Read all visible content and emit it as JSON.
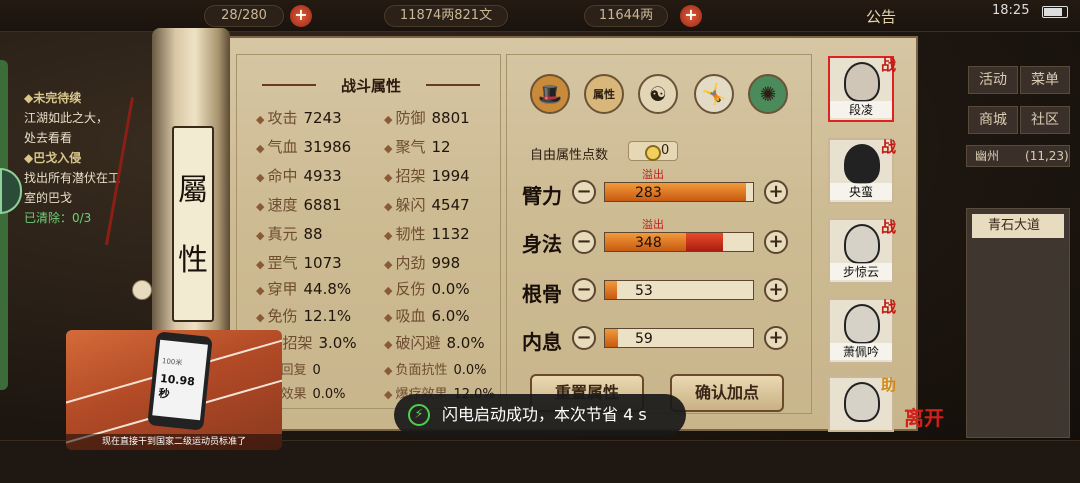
{
  "topbar": {
    "res1": "28/280",
    "res2": "11874两821文",
    "res3": "11644两",
    "notice": "公告",
    "time": "18:25"
  },
  "quest": {
    "title1": "◆未完待续",
    "desc1a": "江湖如此之大，",
    "desc1b": "处去看看",
    "title2": "◆巴戈入侵",
    "desc2a": "找出所有潜伏在工",
    "desc2b": "室的巴戈",
    "cleared": "已清除：0/3"
  },
  "scroll_label": [
    "屬",
    "性"
  ],
  "stats_title": "战斗属性",
  "stats": [
    {
      "k": "攻击",
      "v": "7243"
    },
    {
      "k": "防御",
      "v": "8801"
    },
    {
      "k": "气血",
      "v": "31986"
    },
    {
      "k": "聚气",
      "v": "12"
    },
    {
      "k": "命中",
      "v": "4933"
    },
    {
      "k": "招架",
      "v": "1994"
    },
    {
      "k": "速度",
      "v": "6881"
    },
    {
      "k": "躲闪",
      "v": "4547"
    },
    {
      "k": "真元",
      "v": "88"
    },
    {
      "k": "韧性",
      "v": "1132"
    },
    {
      "k": "罡气",
      "v": "1073"
    },
    {
      "k": "内劲",
      "v": "998"
    },
    {
      "k": "穿甲",
      "v": "44.8%"
    },
    {
      "k": "反伤",
      "v": "0.0%"
    },
    {
      "k": "免伤",
      "v": "12.1%"
    },
    {
      "k": "吸血",
      "v": "6.0%"
    },
    {
      "k": "破招架",
      "v": "3.0%"
    },
    {
      "k": "破闪避",
      "v": "8.0%"
    },
    {
      "k": "血回复",
      "v": "0"
    },
    {
      "k": "负面抗性",
      "v": "0.0%"
    },
    {
      "k": "疗效果",
      "v": "0.0%"
    },
    {
      "k": "爆疗效果",
      "v": "12.0%"
    }
  ],
  "attr": {
    "free_label": "自由属性点数",
    "free_value": "0",
    "overflow_label": "溢出",
    "rows": [
      {
        "name": "臂力",
        "value": "283",
        "fill": 0.95,
        "over": 0.0,
        "overflow": true
      },
      {
        "name": "身法",
        "value": "348",
        "fill": 0.55,
        "over": 0.25,
        "overflow": true
      },
      {
        "name": "根骨",
        "value": "53",
        "fill": 0.08,
        "over": 0.0,
        "overflow": false
      },
      {
        "name": "内息",
        "value": "59",
        "fill": 0.09,
        "over": 0.0,
        "overflow": false
      }
    ],
    "minus": "−",
    "plus": "+",
    "attr_icon": "属性"
  },
  "buttons": {
    "reset": "重置属性",
    "confirm": "确认加点"
  },
  "roster": [
    {
      "name": "段凌",
      "tag": "战"
    },
    {
      "name": "央蛮",
      "tag": "战"
    },
    {
      "name": "步惊云",
      "tag": "战"
    },
    {
      "name": "萧佩吟",
      "tag": "战"
    },
    {
      "name": "",
      "tag": "助"
    }
  ],
  "leave": "离开",
  "menu": {
    "m1": "活动",
    "m2": "菜单",
    "m3": "商城",
    "m4": "社区"
  },
  "location": "幽州",
  "location_coord": "(11,23)",
  "road": "青石大道",
  "video": {
    "small": "100米",
    "time": "10.98秒",
    "caption": "现在直接干到国家二级运动员标准了"
  },
  "toast": "闪电启动成功，本次节省 4 s"
}
